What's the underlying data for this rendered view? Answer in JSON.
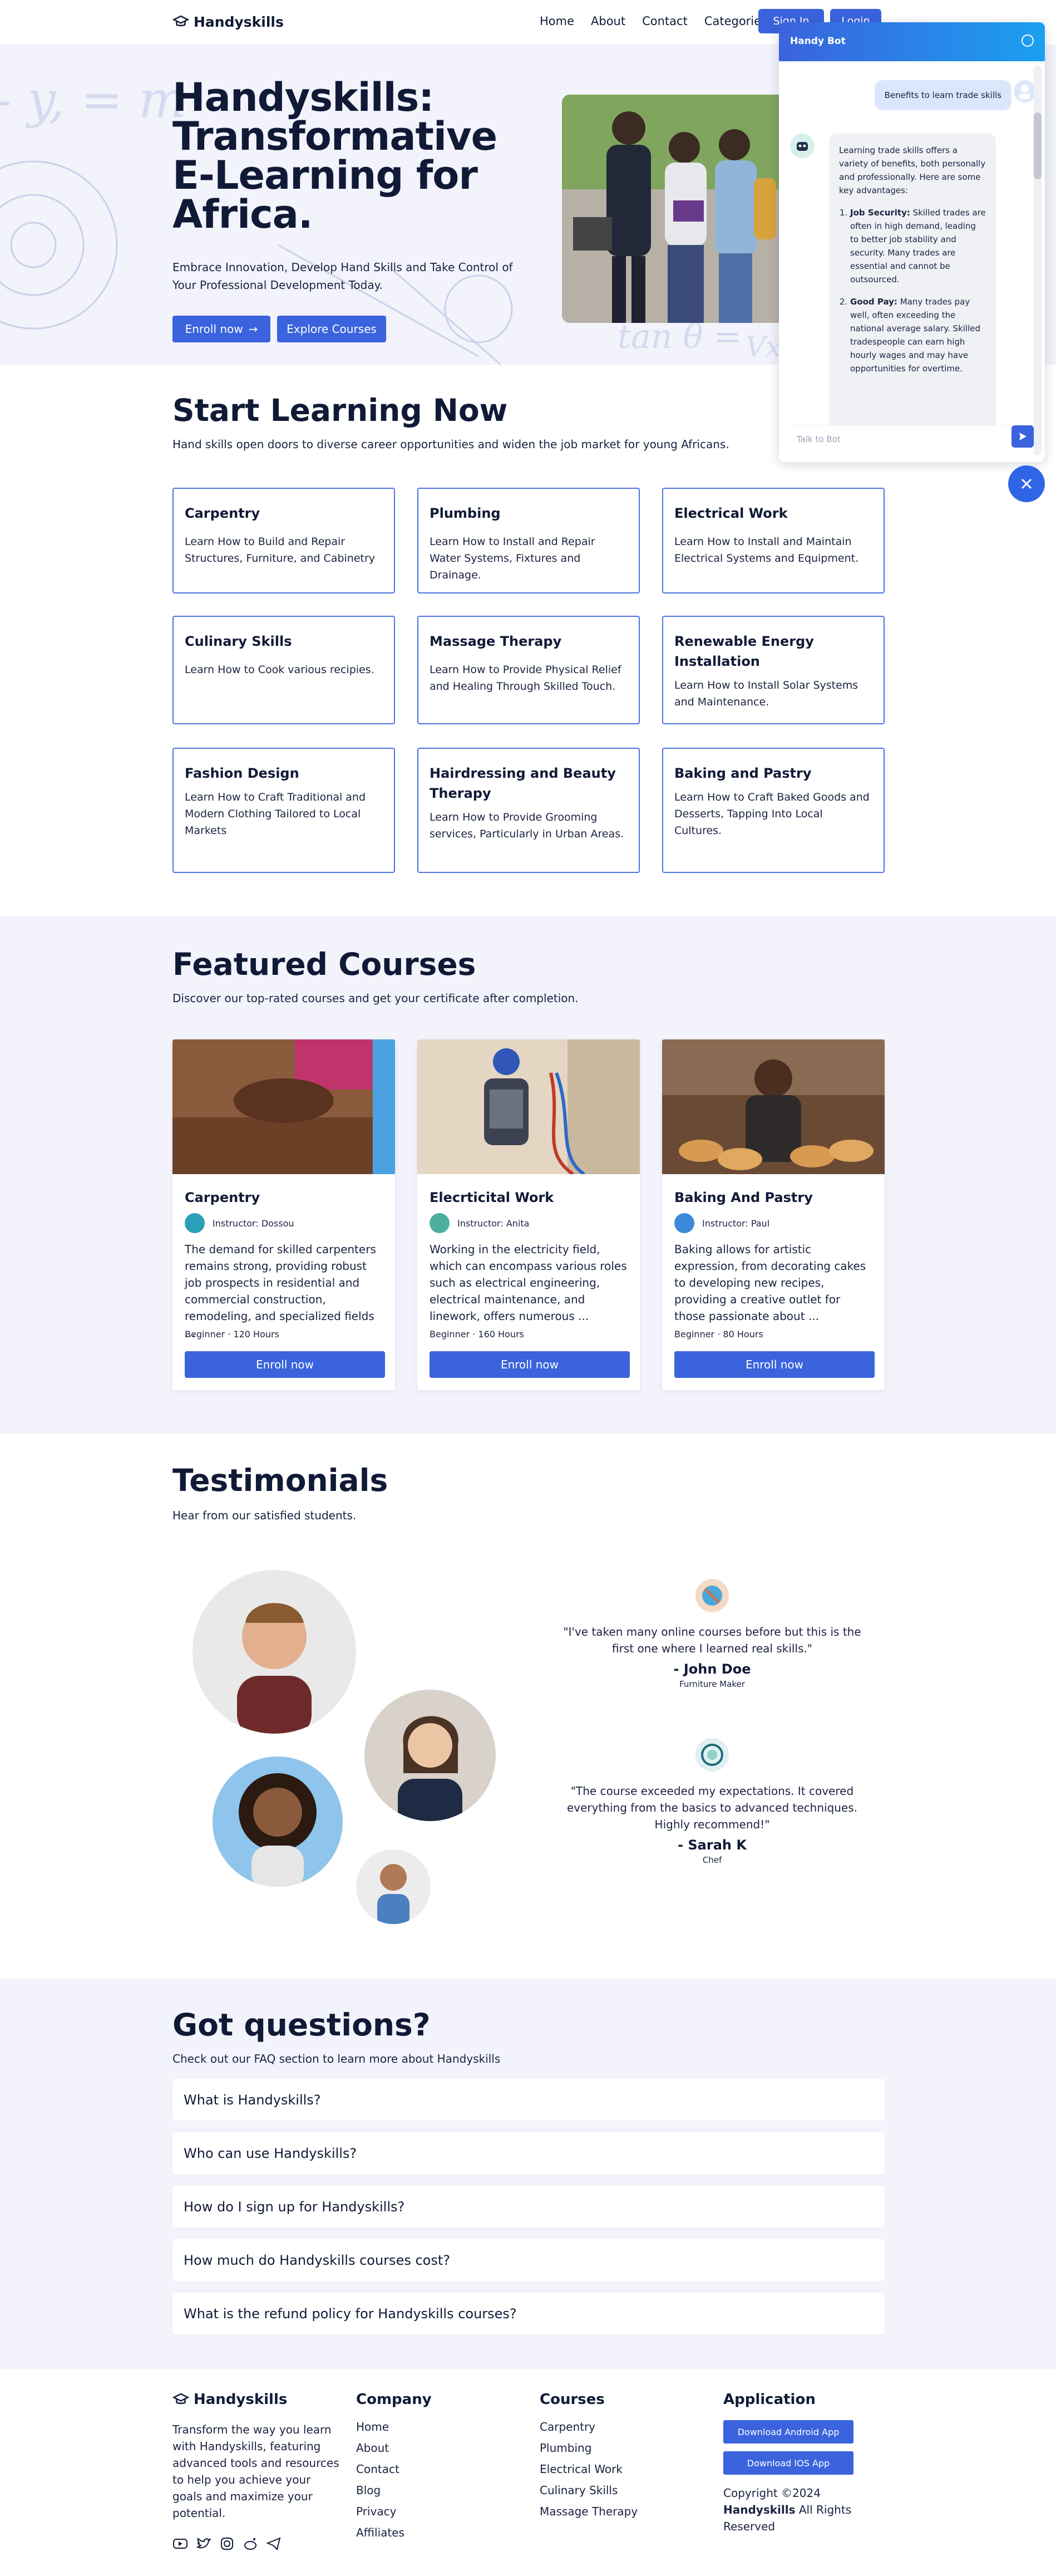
{
  "brand": {
    "name": "Handyskills"
  },
  "nav": {
    "links": [
      "Home",
      "About",
      "Contact",
      "Categories"
    ],
    "signin_label": "Sign In",
    "login_label": "Login"
  },
  "hero": {
    "title": "Handyskills: Transformative E-Learning for Africa.",
    "subtitle": "Embrace Innovation, Develop Hand Skills and Take Control of Your Professional Development Today.",
    "enroll_label": "Enroll now",
    "explore_label": "Explore Courses"
  },
  "learning": {
    "title": "Start Learning Now",
    "subtitle": "Hand skills open doors to diverse career opportunities and widen the job market for young Africans.",
    "skills": [
      {
        "title": "Carpentry",
        "desc": "Learn How to Build and Repair Structures, Furniture, and Cabinetry"
      },
      {
        "title": "Plumbing",
        "desc": "Learn How to Install and Repair Water Systems, Fixtures and Drainage."
      },
      {
        "title": "Electrical Work",
        "desc": "Learn How to Install and Maintain Electrical Systems and Equipment."
      },
      {
        "title": "Culinary Skills",
        "desc": "Learn How to Cook various recipies."
      },
      {
        "title": "Massage Therapy",
        "desc": "Learn How to Provide Physical Relief and Healing Through Skilled Touch."
      },
      {
        "title": "Renewable Energy Installation",
        "desc": "Learn How to Install Solar Systems and Maintenance."
      },
      {
        "title": "Fashion Design",
        "desc": "Learn How to Craft Traditional and Modern Clothing Tailored to Local Markets"
      },
      {
        "title": "Hairdressing and Beauty Therapy",
        "desc": "Learn How to Provide Grooming services, Particularly in Urban Areas."
      },
      {
        "title": "Baking and Pastry",
        "desc": "Learn How to Craft Baked Goods and Desserts, Tapping Into Local Cultures."
      }
    ]
  },
  "featured": {
    "title": "Featured Courses",
    "subtitle": "Discover our top-rated courses and get your certificate after completion.",
    "courses": [
      {
        "title": "Carpentry",
        "instructor": "Instructor: Dossou",
        "desc": "The demand for skilled carpenters remains strong, providing robust job prospects in residential and commercial construction, remodeling, and specialized fields ...",
        "meta": "Beginner · 120 Hours",
        "enroll": "Enroll now"
      },
      {
        "title": "Elecrticital Work",
        "instructor": "Instructor: Anita",
        "desc": "Working in the electricity field, which can encompass various roles such as electrical engineering, electrical maintenance, and linework, offers numerous ...",
        "meta": "Beginner · 160 Hours",
        "enroll": "Enroll now"
      },
      {
        "title": "Baking And Pastry",
        "instructor": "Instructor: Paul",
        "desc": "Baking allows for artistic expression, from decorating cakes to developing new recipes, providing a creative outlet for those passionate about ...",
        "meta": "Beginner · 80 Hours",
        "enroll": "Enroll now"
      }
    ]
  },
  "testimonials": {
    "title": "Testimonials",
    "subtitle": "Hear from our satisfied students.",
    "items": [
      {
        "text": "\"I've taken many online courses before but this is the first one where I learned real skills.\"",
        "name": "- John Doe",
        "role": "Furniture Maker"
      },
      {
        "text": "\"The course exceeded my expectations. It covered everything from the basics to advanced techniques. Highly recommend!\"",
        "name": "- Sarah K",
        "role": "Chef"
      }
    ]
  },
  "faq": {
    "title": "Got questions?",
    "subtitle": "Check out our FAQ section to learn more about Handyskills",
    "questions": [
      "What is Handyskills?",
      "Who can use Handyskills?",
      "How do I sign up for Handyskills?",
      "How much do Handyskills courses cost?",
      "What is the refund policy for Handyskills courses?"
    ]
  },
  "footer": {
    "about": "Transform the way you learn with Handyskills, featuring advanced tools and resources to help you achieve your goals and maximize your potential.",
    "company": {
      "title": "Company",
      "links": [
        "Home",
        "About",
        "Contact",
        "Blog",
        "Privacy",
        "Affiliates"
      ]
    },
    "courses": {
      "title": "Courses",
      "links": [
        "Carpentry",
        "Plumbing",
        "Electrical Work",
        "Culinary Skills",
        "Massage Therapy"
      ]
    },
    "application": {
      "title": "Application",
      "android": "Download Android App",
      "ios": "Download IOS App",
      "copyright": "Copyright ©2024",
      "brand": "Handyskills",
      "rights": "All Rights Reserved"
    }
  },
  "chat": {
    "title": "Handy Bot",
    "user_message": "Benefits to learn trade skills",
    "bot_intro": "Learning trade skills offers a variety of benefits, both personally and professionally. Here are some key advantages:",
    "bot_points": [
      {
        "title": "Job Security:",
        "text": " Skilled trades are often in high demand, leading to better job stability and security. Many trades are essential and cannot be outsourced."
      },
      {
        "title": "Good Pay:",
        "text": " Many trades pay well, often exceeding the national average salary. Skilled tradespeople can earn high hourly wages and may have opportunities for overtime."
      }
    ],
    "input_placeholder": "Talk to Bot"
  },
  "colors": {
    "primary": "#3a63dd",
    "dark": "#101a36",
    "section_bg": "#f2f3fb"
  }
}
